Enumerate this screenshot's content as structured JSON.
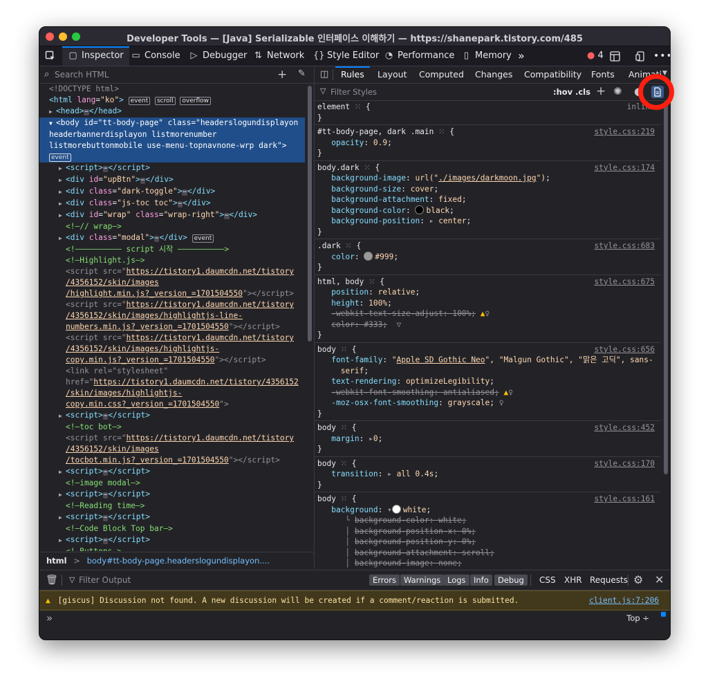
{
  "window": {
    "title": "Developer Tools — [Java] Serializable 인터페이스 이해하기 — https://shanepark.tistory.com/485"
  },
  "toolbar": {
    "picker_icon": "pick-element-icon",
    "tabs": [
      {
        "label": "Inspector",
        "icon": "inspector-icon"
      },
      {
        "label": "Console",
        "icon": "console-icon"
      },
      {
        "label": "Debugger",
        "icon": "debugger-icon"
      },
      {
        "label": "Network",
        "icon": "network-icon"
      },
      {
        "label": "Style Editor",
        "icon": "style-editor-icon"
      },
      {
        "label": "Performance",
        "icon": "performance-icon"
      },
      {
        "label": "Memory",
        "icon": "memory-icon"
      }
    ],
    "more": "»",
    "error_count": "4"
  },
  "html_panel": {
    "search_placeholder": "Search HTML",
    "breadcrumb": {
      "root": "html",
      "sep": ">",
      "current": "body#tt-body-page.headerslogundisplayon...."
    }
  },
  "rules_panel": {
    "tabs": [
      "Rules",
      "Layout",
      "Computed",
      "Changes",
      "Compatibility",
      "Fonts",
      "Animations"
    ],
    "filter_placeholder": "Filter Styles",
    "hov": ":hov",
    "cls": ".cls"
  },
  "console": {
    "filter_placeholder": "Filter Output",
    "levels": [
      "Errors",
      "Warnings",
      "Logs",
      "Info",
      "Debug"
    ],
    "types": [
      "CSS",
      "XHR",
      "Requests"
    ],
    "warning_text": "[giscus] Discussion not found. A new discussion will be created if a comment/reaction is submitted.",
    "warning_source": "client.js:7:206",
    "context": "Top ÷",
    "prompt": "»"
  },
  "colors": {
    "accent": "#0a84ff",
    "highlight_ring": "#ff1f0f",
    "selection": "#204e8a"
  }
}
